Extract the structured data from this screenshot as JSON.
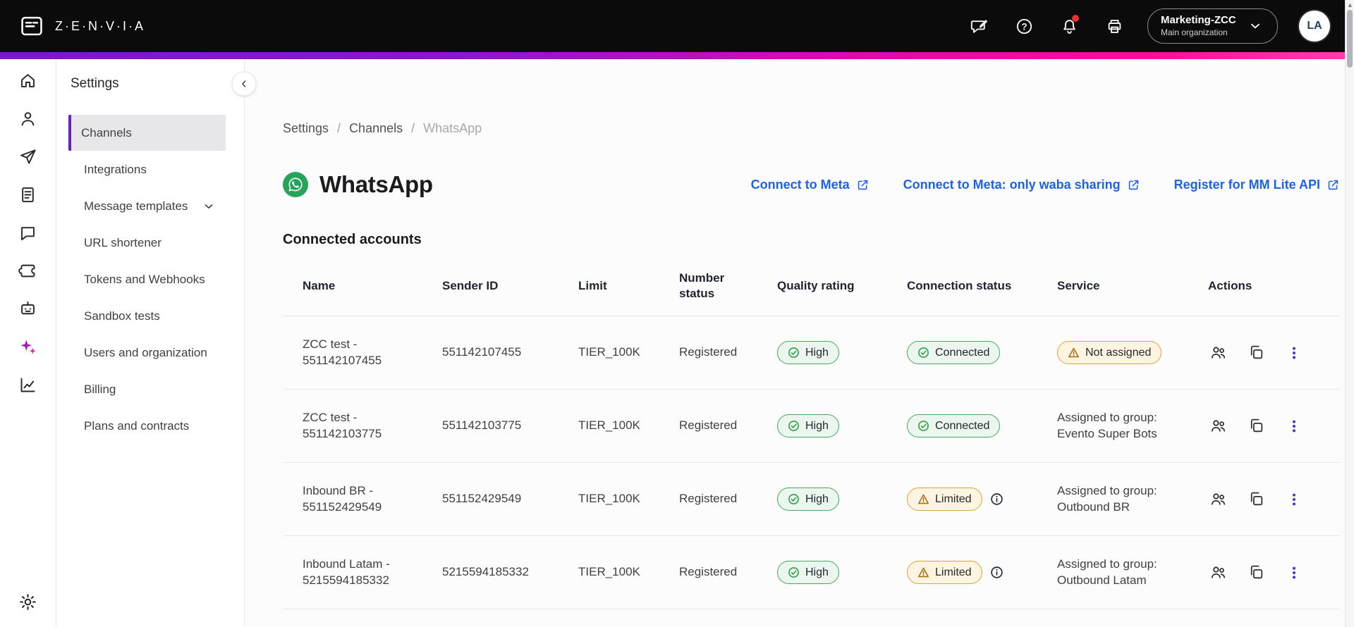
{
  "topbar": {
    "brand": "Z·E·N·V·I·A",
    "org": {
      "name": "Marketing-ZCC",
      "subtitle": "Main organization"
    },
    "avatar_initials": "LA"
  },
  "sidebar": {
    "title": "Settings",
    "items": [
      "Channels",
      "Integrations",
      "Message templates",
      "URL shortener",
      "Tokens and Webhooks",
      "Sandbox tests",
      "Users and organization",
      "Billing",
      "Plans and contracts"
    ],
    "active_item": "Channels"
  },
  "breadcrumb": {
    "items": [
      "Settings",
      "Channels",
      "WhatsApp"
    ]
  },
  "page": {
    "title": "WhatsApp",
    "links": [
      "Connect to Meta",
      "Connect to Meta: only waba sharing",
      "Register for MM Lite API"
    ],
    "section": "Connected accounts"
  },
  "table": {
    "headers": [
      "Name",
      "Sender ID",
      "Limit",
      "Number status",
      "Quality rating",
      "Connection status",
      "Service",
      "Actions"
    ],
    "rows": [
      {
        "name": "ZCC test - 551142107455",
        "sender_id": "551142107455",
        "limit": "TIER_100K",
        "number_status": "Registered",
        "quality_rating": "High",
        "connection_status": "Connected",
        "service": "Not assigned"
      },
      {
        "name": "ZCC test - 551142103775",
        "sender_id": "551142103775",
        "limit": "TIER_100K",
        "number_status": "Registered",
        "quality_rating": "High",
        "connection_status": "Connected",
        "service": "Assigned to group: Evento Super Bots"
      },
      {
        "name": "Inbound BR - 551152429549",
        "sender_id": "551152429549",
        "limit": "TIER_100K",
        "number_status": "Registered",
        "quality_rating": "High",
        "connection_status": "Limited",
        "service": "Assigned to group: Outbound BR"
      },
      {
        "name": "Inbound Latam - 5215594185332",
        "sender_id": "5215594185332",
        "limit": "TIER_100K",
        "number_status": "Registered",
        "quality_rating": "High",
        "connection_status": "Limited",
        "service": "Assigned to group: Outbound Latam"
      }
    ]
  },
  "colors": {
    "topbar_bg": "#0b0b0c",
    "gradient_start": "#7b16d3",
    "gradient_end": "#ff3fae",
    "accent_purple": "#6d1fd0",
    "link_blue": "#1c63e8",
    "success_green": "#2f9e44",
    "warning_amber": "#d9a43a",
    "whatsapp_green": "#25a45a",
    "notification_red": "#e8342c"
  }
}
